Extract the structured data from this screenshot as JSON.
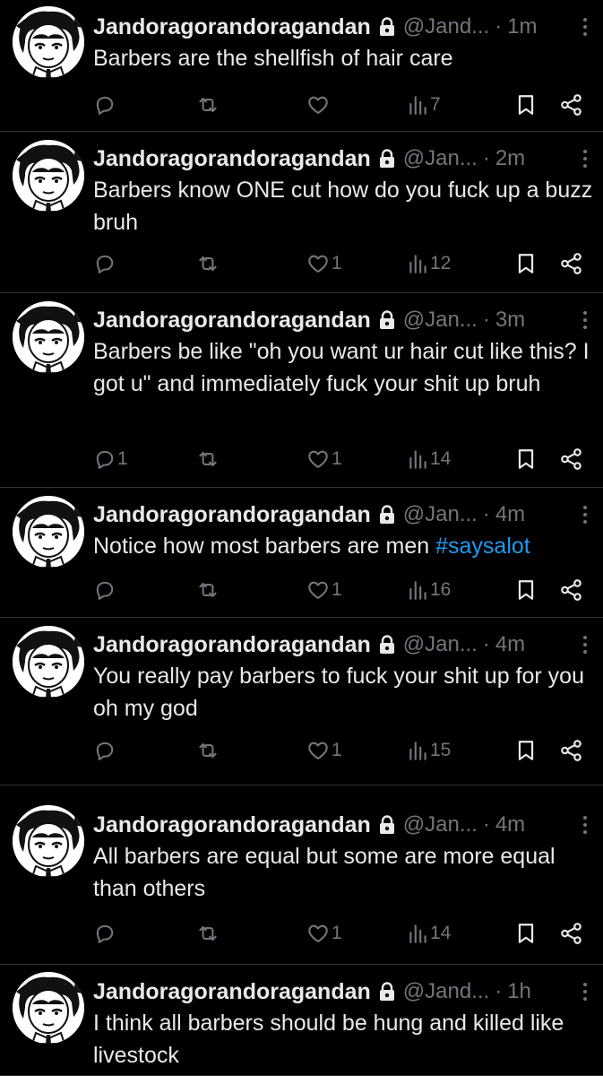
{
  "tweets": [
    {
      "name": "Jandoragorandoragandan",
      "handle": "@Jand...",
      "time": "1m",
      "text": "Barbers are the shellfish of hair care",
      "hashtag": "",
      "replies": "",
      "reposts": "",
      "likes": "",
      "views": "7"
    },
    {
      "name": "Jandoragorandoragandan",
      "handle": "@Jan...",
      "time": "2m",
      "text": "Barbers know ONE cut how do you fuck up a buzz bruh",
      "hashtag": "",
      "replies": "",
      "reposts": "",
      "likes": "1",
      "views": "12"
    },
    {
      "name": "Jandoragorandoragandan",
      "handle": "@Jan...",
      "time": "3m",
      "text": "Barbers be like \"oh you want ur hair cut like this? I got u\" and immediately fuck your shit up bruh",
      "hashtag": "",
      "replies": "1",
      "reposts": "",
      "likes": "1",
      "views": "14"
    },
    {
      "name": "Jandoragorandoragandan",
      "handle": "@Jan...",
      "time": "4m",
      "text": "Notice how most barbers are men ",
      "hashtag": "#saysalot",
      "replies": "",
      "reposts": "",
      "likes": "1",
      "views": "16"
    },
    {
      "name": "Jandoragorandoragandan",
      "handle": "@Jan...",
      "time": "4m",
      "text": "You really pay barbers to fuck your shit up for you oh my god",
      "hashtag": "",
      "replies": "",
      "reposts": "",
      "likes": "1",
      "views": "15"
    },
    {
      "name": "Jandoragorandoragandan",
      "handle": "@Jan...",
      "time": "4m",
      "text": "All barbers are equal but some are more equal than others",
      "hashtag": "",
      "replies": "",
      "reposts": "",
      "likes": "1",
      "views": "14"
    },
    {
      "name": "Jandoragorandoragandan",
      "handle": "@Jand...",
      "time": "1h",
      "text": "I think all barbers should be hung and killed like livestock",
      "hashtag": "",
      "replies": "",
      "reposts": "",
      "likes": "",
      "views": ""
    }
  ],
  "colors": {
    "background": "#000000",
    "text": "#e7e9ea",
    "secondary": "#71767b",
    "link": "#1d9bf0",
    "divider": "#2f3336"
  },
  "icons": {
    "verified_lock": "lock-icon",
    "reply": "reply-icon",
    "repost": "repost-icon",
    "like": "heart-icon",
    "views": "views-icon",
    "bookmark": "bookmark-icon",
    "share": "share-icon",
    "more": "more-icon",
    "avatar": "avatar-image"
  }
}
